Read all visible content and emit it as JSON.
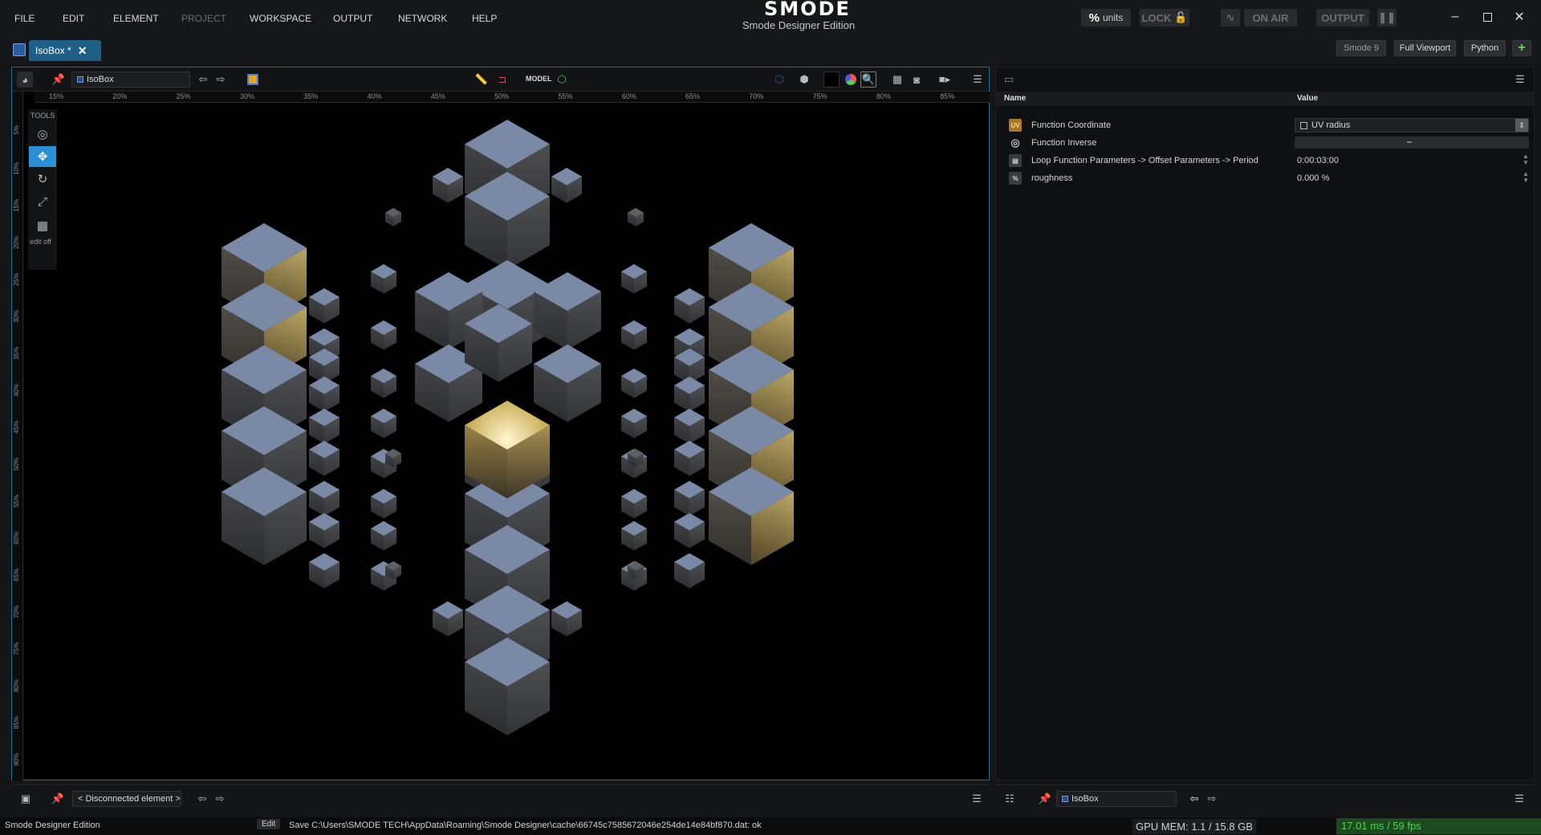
{
  "menu": {
    "items": [
      {
        "label": "FILE",
        "enabled": true
      },
      {
        "label": "EDIT",
        "enabled": true
      },
      {
        "label": "ELEMENT",
        "enabled": true
      },
      {
        "label": "PROJECT",
        "enabled": false
      },
      {
        "label": "WORKSPACE",
        "enabled": true
      },
      {
        "label": "OUTPUT",
        "enabled": true
      },
      {
        "label": "NETWORK",
        "enabled": true
      },
      {
        "label": "HELP",
        "enabled": true
      }
    ]
  },
  "brand": {
    "logo": "SMODE",
    "edition": "Smode Designer Edition"
  },
  "header": {
    "units_label": "units",
    "units_symbol": "%",
    "lock_label": "LOCK",
    "on_air_label": "ON AIR",
    "output_label": "OUTPUT"
  },
  "tab": {
    "label": "IsoBox *"
  },
  "tabbar": {
    "smode_label": "Smode 9",
    "full_viewport_label": "Full Viewport",
    "python_label": "Python"
  },
  "viewport": {
    "path": "IsoBox",
    "model_label": "MODEL",
    "tools_label": "TOOLS",
    "edit_off_label": "edit off",
    "ruler_h": [
      "15%",
      "20%",
      "25%",
      "30%",
      "35%",
      "40%",
      "45%",
      "50%",
      "55%",
      "60%",
      "65%",
      "70%",
      "75%",
      "80%",
      "85%"
    ],
    "ruler_v": [
      "5%",
      "10%",
      "15%",
      "20%",
      "25%",
      "30%",
      "35%",
      "40%",
      "45%",
      "50%",
      "55%",
      "60%",
      "65%",
      "70%",
      "75%",
      "80%",
      "85%",
      "90%"
    ],
    "bottom_path": "< Disconnected element >"
  },
  "properties": {
    "col_name": "Name",
    "col_value": "Value",
    "rows": [
      {
        "icon": "uv-icon",
        "icon_text": "UV",
        "name": "Function Coordinate",
        "value": "UV radius"
      },
      {
        "icon": "circle-icon",
        "icon_text": "",
        "name": "Function Inverse",
        "value": ""
      },
      {
        "icon": "loop-icon",
        "icon_text": "",
        "name": "Loop Function Parameters -> Offset Parameters -> Period",
        "value": "0:00:03:00"
      },
      {
        "icon": "percent-icon",
        "icon_text": "%",
        "name": "roughness",
        "value": "0.000 %"
      }
    ],
    "bottom_path": "IsoBox"
  },
  "status": {
    "app": "Smode Designer Edition",
    "mode": "Edit",
    "message": "Save C:\\Users\\SMODE TECH\\AppData\\Roaming\\Smode Designer\\cache\\66745c7585672046e254de14e84bf870.dat: ok",
    "gpu_mem": "GPU MEM: 1.1 / 15.8 GB",
    "fps": "17.01 ms / 59 fps"
  },
  "colors": {
    "accent": "#2b8fd6",
    "tab": "#1e5f87",
    "fps_bg": "#1d4a1f",
    "fps_text": "#4fd24f"
  }
}
